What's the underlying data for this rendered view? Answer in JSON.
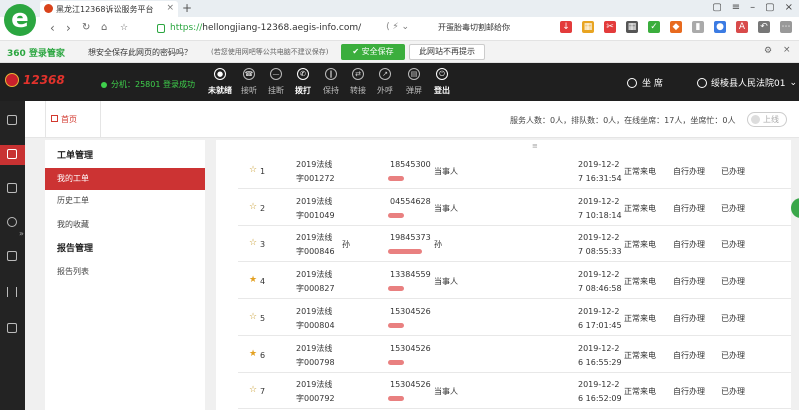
{
  "browser": {
    "logo_letter": "e",
    "tab_title": "黑龙江12368诉讼服务平台",
    "url_scheme": "https://",
    "url_host": "hellongjiang-12368.aegis-info.com",
    "url_rest": "/",
    "search_hint": "开蛋胎毒切割邮给你"
  },
  "pw_bar": {
    "brand": "360 登录管家",
    "question": "想安全保存此网页的密码吗？",
    "note": "(若您使用网吧等公共电脑不建议保存)",
    "save_label": "安全保存",
    "never_label": "此网站不再提示"
  },
  "app": {
    "name": "12368",
    "seat_status": "分机：25801 登录成功",
    "controls": [
      {
        "label": "未就绪",
        "icon": "user-dot-icon",
        "on": true
      },
      {
        "label": "接听",
        "icon": "answer-icon",
        "on": false
      },
      {
        "label": "挂断",
        "icon": "hangup-icon",
        "on": false
      },
      {
        "label": "拨打",
        "icon": "dial-icon",
        "on": true
      },
      {
        "label": "保持",
        "icon": "hold-icon",
        "on": false
      },
      {
        "label": "转接",
        "icon": "transfer-icon",
        "on": false
      },
      {
        "label": "外呼",
        "icon": "outbound-icon",
        "on": false
      },
      {
        "label": "弹屏",
        "icon": "popup-icon",
        "on": false
      },
      {
        "label": "登出",
        "icon": "power-icon",
        "on": true
      }
    ],
    "seat_label": "坐 席",
    "user_label": "绥棱县人民法院01"
  },
  "tabs": {
    "home_label": "首页",
    "stats": "服务人数：0人，排队数：0人，在线坐席：17人，坐席忙：0人",
    "online_label": "上线"
  },
  "menu": {
    "group1": "工单管理",
    "items1": [
      "我的工单",
      "历史工单",
      "我的收藏"
    ],
    "group2": "报告管理",
    "items2": [
      "报告列表"
    ]
  },
  "table": {
    "rows": [
      {
        "no": "1",
        "starred": false,
        "case1": "2019法线",
        "case2": "字001272",
        "name": "",
        "phone": "18545300",
        "role": "当事人",
        "date1": "2019-12-2",
        "date2": "7 16:31:54",
        "type": "正常来电",
        "handle": "自行办理",
        "status": "已办理"
      },
      {
        "no": "2",
        "starred": false,
        "case1": "2019法线",
        "case2": "字001049",
        "name": "",
        "phone": "04554628",
        "role": "当事人",
        "date1": "2019-12-2",
        "date2": "7 10:18:14",
        "type": "正常来电",
        "handle": "自行办理",
        "status": "已办理"
      },
      {
        "no": "3",
        "starred": false,
        "case1": "2019法线",
        "case2": "字000846",
        "name": "孙",
        "phone": "19845373",
        "role": "孙",
        "date1": "2019-12-2",
        "date2": "7 08:55:33",
        "type": "正常来电",
        "handle": "自行办理",
        "status": "已办理"
      },
      {
        "no": "4",
        "starred": true,
        "case1": "2019法线",
        "case2": "字000827",
        "name": "",
        "phone": "13384559",
        "role": "当事人",
        "date1": "2019-12-2",
        "date2": "7 08:46:58",
        "type": "正常来电",
        "handle": "自行办理",
        "status": "已办理"
      },
      {
        "no": "5",
        "starred": false,
        "case1": "2019法线",
        "case2": "字000804",
        "name": "",
        "phone": "15304526",
        "role": "",
        "date1": "2019-12-2",
        "date2": "6 17:01:45",
        "type": "正常来电",
        "handle": "自行办理",
        "status": "已办理"
      },
      {
        "no": "6",
        "starred": true,
        "case1": "2019法线",
        "case2": "字000798",
        "name": "",
        "phone": "15304526",
        "role": "",
        "date1": "2019-12-2",
        "date2": "6 16:55:29",
        "type": "正常来电",
        "handle": "自行办理",
        "status": "已办理"
      },
      {
        "no": "7",
        "starred": false,
        "case1": "2019法线",
        "case2": "字000792",
        "name": "",
        "phone": "15304526",
        "role": "当事人",
        "date1": "2019-12-2",
        "date2": "6 16:52:09",
        "type": "正常来电",
        "handle": "自行办理",
        "status": "已办理"
      }
    ]
  },
  "colors": {
    "accent_red": "#cc3333",
    "browser_green": "#2ba640",
    "header_dark": "#1f1f1f",
    "status_green": "#3fd04c"
  }
}
